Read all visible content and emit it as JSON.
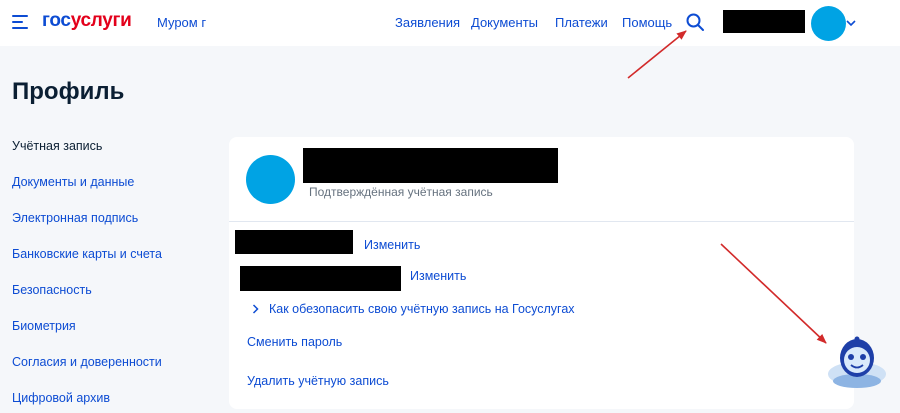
{
  "header": {
    "logo_gos": "гос",
    "logo_uslugi": "услуги",
    "region": "Муром г",
    "nav": [
      {
        "label": "Заявления"
      },
      {
        "label": "Документы"
      },
      {
        "label": "Платежи"
      },
      {
        "label": "Помощь"
      }
    ],
    "icons": {
      "menu": "burger-icon",
      "search": "search-icon",
      "expand": "chevron-down-icon"
    }
  },
  "page": {
    "title": "Профиль"
  },
  "sidebar": {
    "items": [
      {
        "label": "Учётная запись",
        "active": true
      },
      {
        "label": "Документы и данные"
      },
      {
        "label": "Электронная подпись"
      },
      {
        "label": "Банковские карты и счета"
      },
      {
        "label": "Безопасность"
      },
      {
        "label": "Биометрия"
      },
      {
        "label": "Согласия и доверенности"
      },
      {
        "label": "Цифровой архив"
      }
    ]
  },
  "account": {
    "status": "Подтверждённая учётная запись",
    "change_label_1": "Изменить",
    "change_label_2": "Изменить",
    "secure_link": "Как обезопасить свою учётную запись на Госуслугах",
    "change_password": "Сменить пароль",
    "delete_account": "Удалить учётную запись"
  },
  "colors": {
    "brand_blue": "#0d4cd3",
    "brand_red": "#e3001b",
    "avatar": "#00a3e4",
    "background": "#f5f7fa",
    "annotation_arrow": "#d22a2a"
  }
}
